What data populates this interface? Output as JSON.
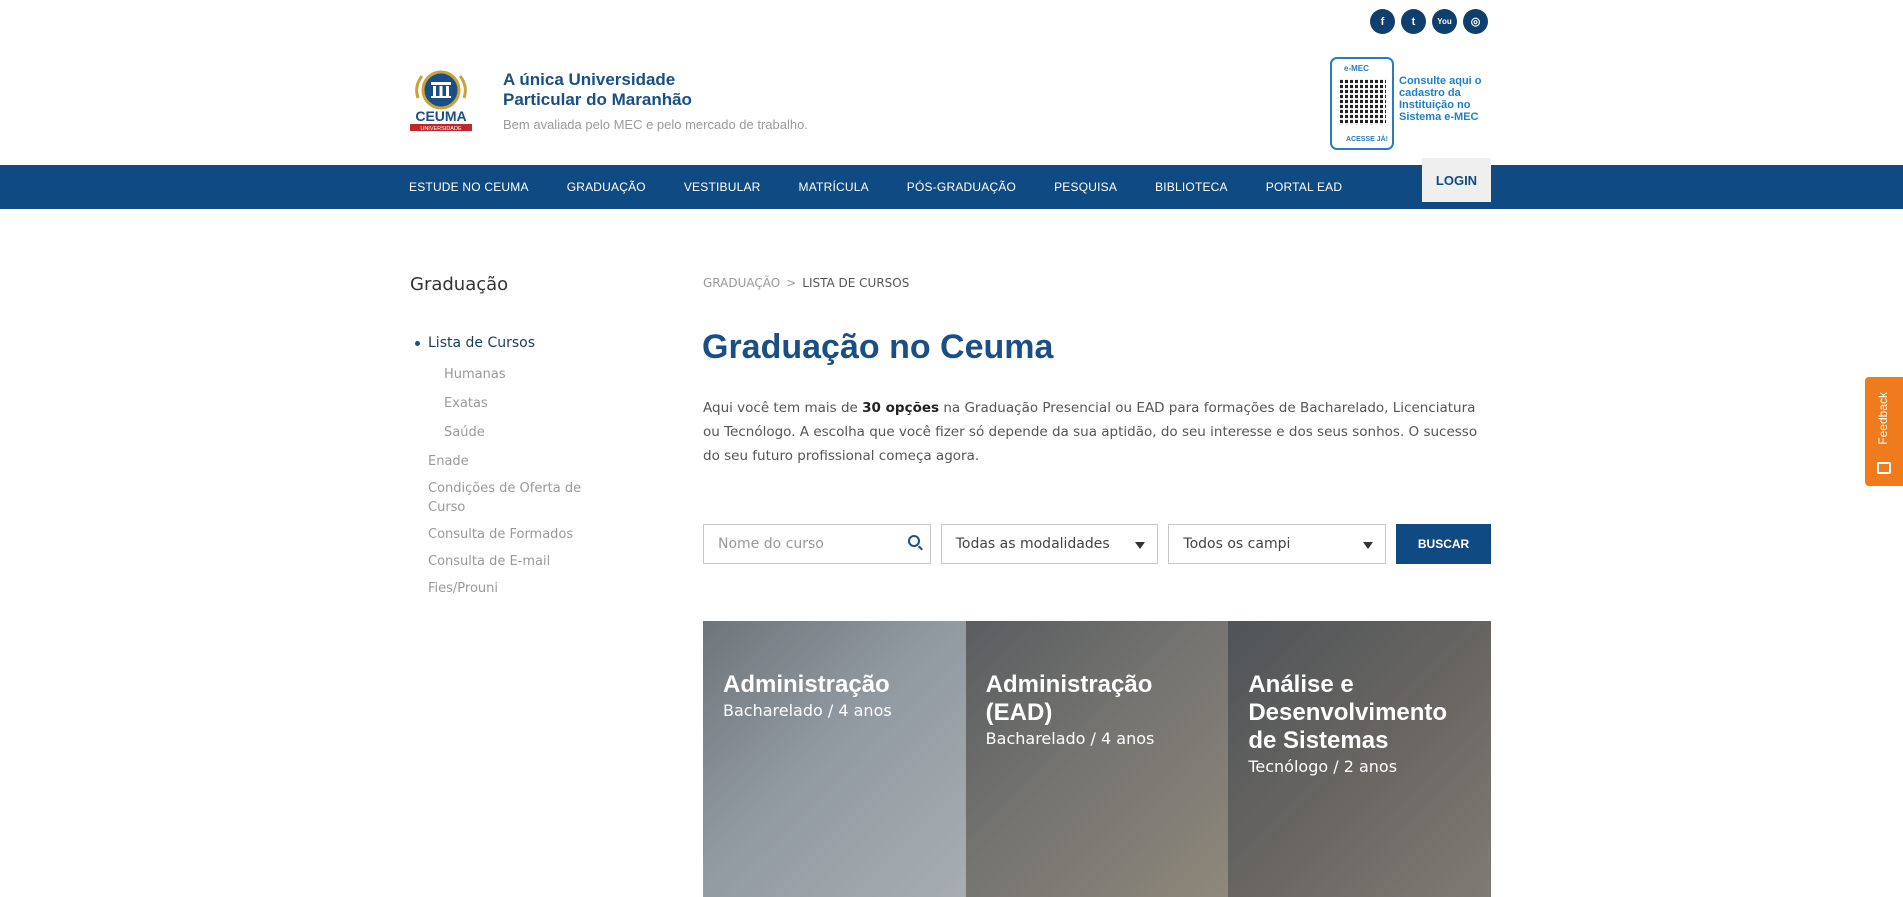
{
  "social": {
    "facebook": "f",
    "twitter": "t",
    "youtube": "You",
    "instagram": "◎"
  },
  "header": {
    "tagline_line1": "A única Universidade",
    "tagline_line2": "Particular do Maranhão",
    "subtitle": "Bem avaliada pelo MEC e pelo mercado de trabalho.",
    "logo_text": "CEUMA",
    "logo_sub": "UNIVERSIDADE",
    "emec_logo": "e-MEC",
    "emec_acesse": "ACESSE JÁ!",
    "emec_text": "Consulte aqui o cadastro da Instituição no Sistema e-MEC"
  },
  "nav": {
    "items": [
      "ESTUDE NO CEUMA",
      "GRADUAÇÃO",
      "VESTIBULAR",
      "MATRÍCULA",
      "PÓS-GRADUAÇÃO",
      "PESQUISA",
      "BIBLIOTECA",
      "PORTAL EAD"
    ],
    "login": "LOGIN"
  },
  "sidebar": {
    "title": "Graduação",
    "active": "Lista de Cursos",
    "sub": [
      "Humanas",
      "Exatas",
      "Saúde"
    ],
    "items": [
      "Enade",
      "Condições de Oferta de Curso",
      "Consulta de Formados",
      "Consulta de E-mail",
      "Fies/Prouni"
    ]
  },
  "breadcrumb": {
    "parent": "GRADUAÇÃO",
    "sep": ">",
    "current": "LISTA DE CURSOS"
  },
  "main": {
    "title": "Graduação no Ceuma",
    "intro_a": "Aqui você tem mais de ",
    "intro_b": "30 opções",
    "intro_c": " na Graduação Presencial ou EAD para formações de Bacharelado, Licenciatura ou Tecnólogo. A escolha que você fizer só depende da sua aptidão, do seu interesse e dos seus sonhos. O sucesso do seu futuro profissional começa agora."
  },
  "search": {
    "placeholder": "Nome do curso",
    "modalidade": "Todas as modalidades",
    "campi": "Todos os campi",
    "button": "BUSCAR"
  },
  "courses": [
    {
      "title": "Administração",
      "sub": "Bacharelado / 4 anos"
    },
    {
      "title": "Administração (EAD)",
      "sub": "Bacharelado / 4 anos"
    },
    {
      "title": "Análise e Desenvolvimento de Sistemas",
      "sub": "Tecnólogo / 2 anos"
    }
  ],
  "feedback": "Feedback",
  "colors": {
    "brand": "#0f4b82",
    "title": "#1a4f86",
    "feedback": "#f07b1c"
  }
}
